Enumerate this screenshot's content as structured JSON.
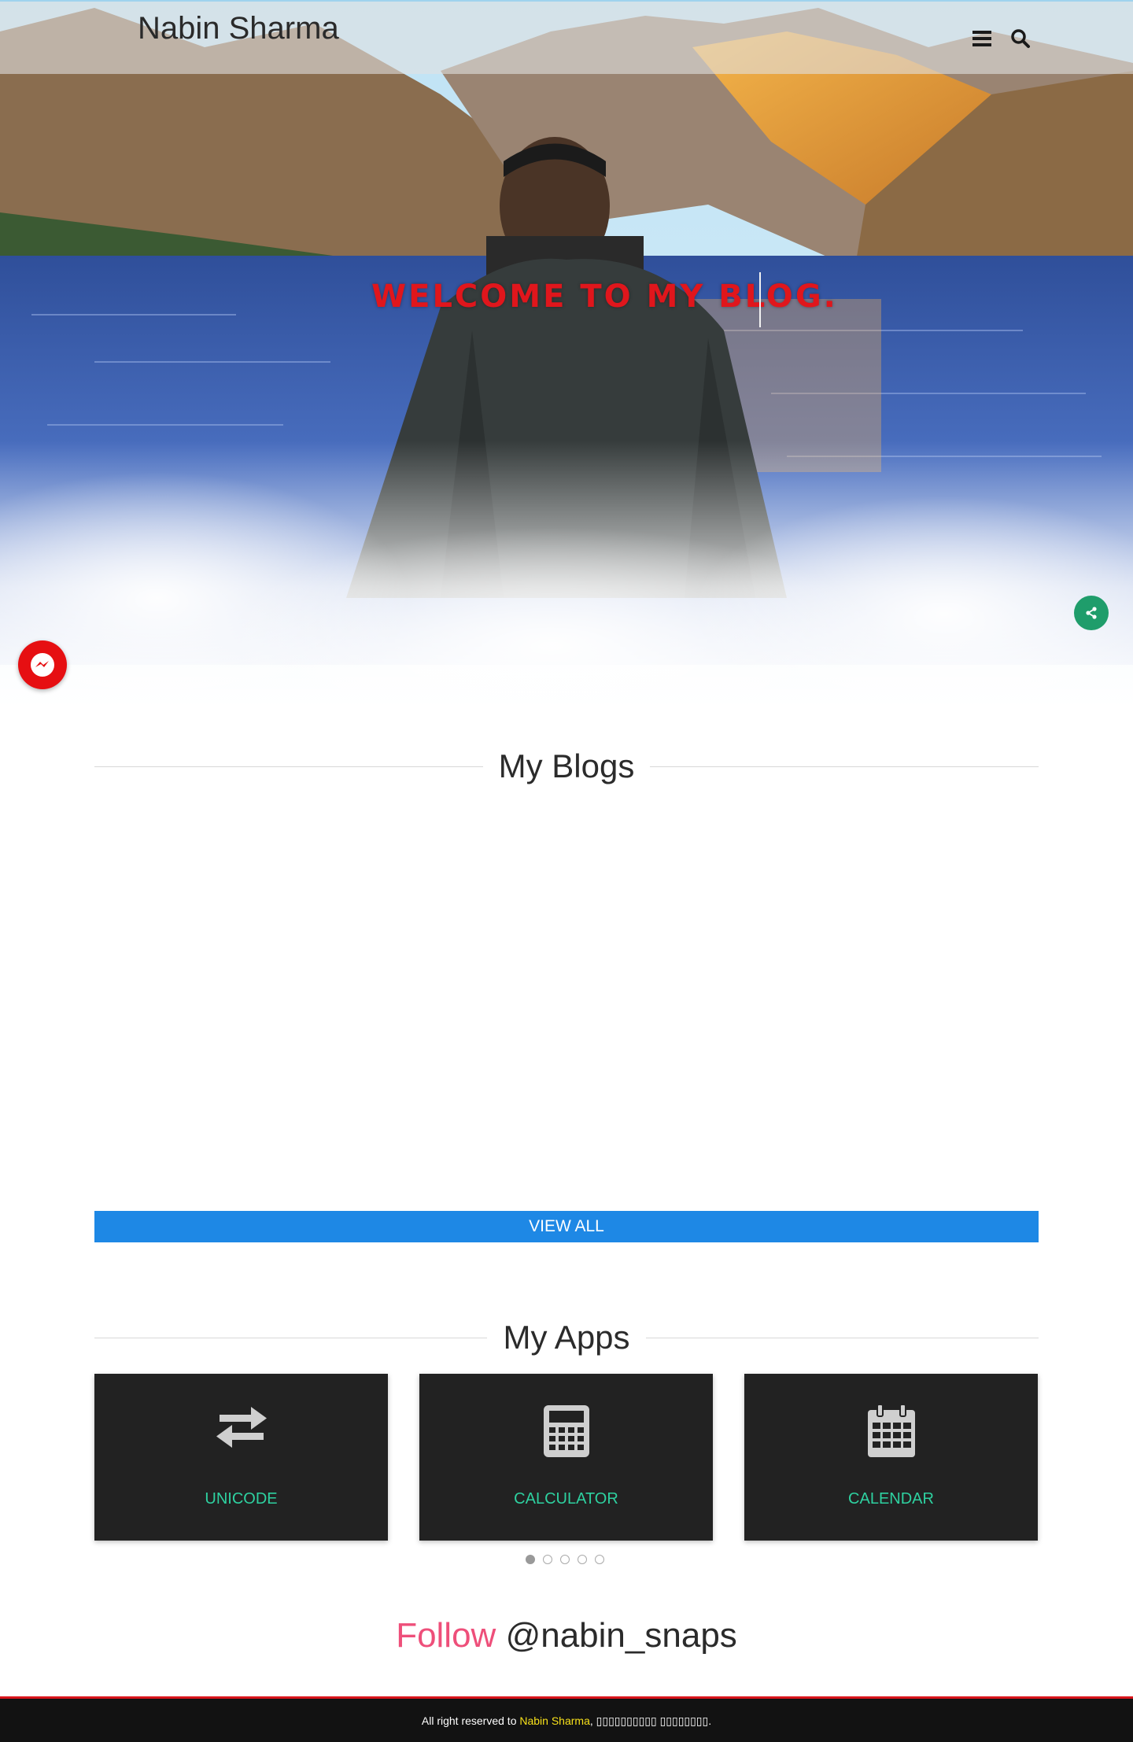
{
  "header": {
    "site_title": "Nabin Sharma",
    "menu_icon": "bars-icon",
    "search_icon": "search-icon"
  },
  "hero": {
    "welcome_text": "WELCOME TO MY BLOG.",
    "share_icon": "share-icon",
    "messenger_icon": "messenger-icon"
  },
  "blogs": {
    "heading": "My Blogs",
    "view_all_label": "VIEW ALL"
  },
  "apps": {
    "heading": "My Apps",
    "items": [
      {
        "label": "UNICODE",
        "icon": "exchange-arrows-icon"
      },
      {
        "label": "CALCULATOR",
        "icon": "calculator-icon"
      },
      {
        "label": "CALENDAR",
        "icon": "calendar-icon"
      }
    ],
    "pagination_count": 5,
    "active_page": 1
  },
  "follow": {
    "word": "Follow",
    "handle": "@nabin_snaps"
  },
  "footer": {
    "prefix": "All right reserved to ",
    "owner": "Nabin Sharma",
    "suffix": ", ▯▯▯▯▯▯▯▯▯▯ ▯▯▯▯▯▯▯▯."
  },
  "colors": {
    "accent_blue": "#1e88e5",
    "app_label_green": "#2ed1a0",
    "welcome_red": "#e0161c",
    "follow_pink": "#ee4f7a",
    "footer_owner_yellow": "#f7e01a",
    "share_green": "#1f9d6b",
    "messenger_red": "#e60f12"
  }
}
